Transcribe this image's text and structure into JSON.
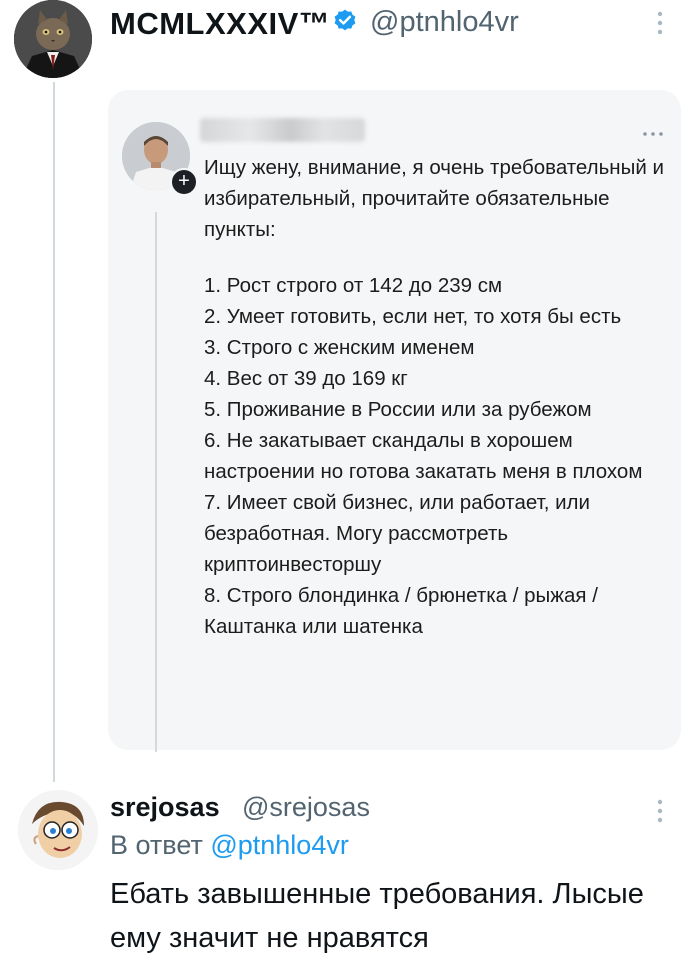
{
  "original_tweet": {
    "author_name": "MCMLXXXIV™",
    "author_handle": "@ptnhlo4vr",
    "verified_icon": "verified-badge-icon",
    "menu_icon": "more-vertical-icon",
    "verified_color": "#1d9bf0"
  },
  "quoted_tweet": {
    "menu_icon": "more-horizontal-icon",
    "follow_icon": "plus-icon",
    "intro": "Ищу жену, внимание, я очень требовательный и избирательный, прочитайте обязательные пункты:",
    "items": [
      "1. Рост строго от 142 до 239 см",
      "2. Умеет готовить, если нет, то хотя бы есть",
      "3. Строго с женским именем",
      "4. Вес от 39 до 169 кг",
      "5. Проживание в России или за рубежом",
      "6. Не закатывает скандалы в хорошем настроении но готова закатать меня в плохом",
      "7. Имеет свой бизнес, или работает, или безработная. Могу рассмотреть криптоинвесторшу",
      "8. Строго блондинка / брюнетка / рыжая / Каштанка или шатенка"
    ]
  },
  "reply_tweet": {
    "author_name": "srejosas",
    "author_handle": "@srejosas",
    "reply_prefix": "В ответ",
    "reply_mention": "@ptnhlo4vr",
    "menu_icon": "more-vertical-icon",
    "text": "Ебать завышенные требования. Лысые ему значит не нравятся",
    "mention_color": "#1d9bf0"
  }
}
